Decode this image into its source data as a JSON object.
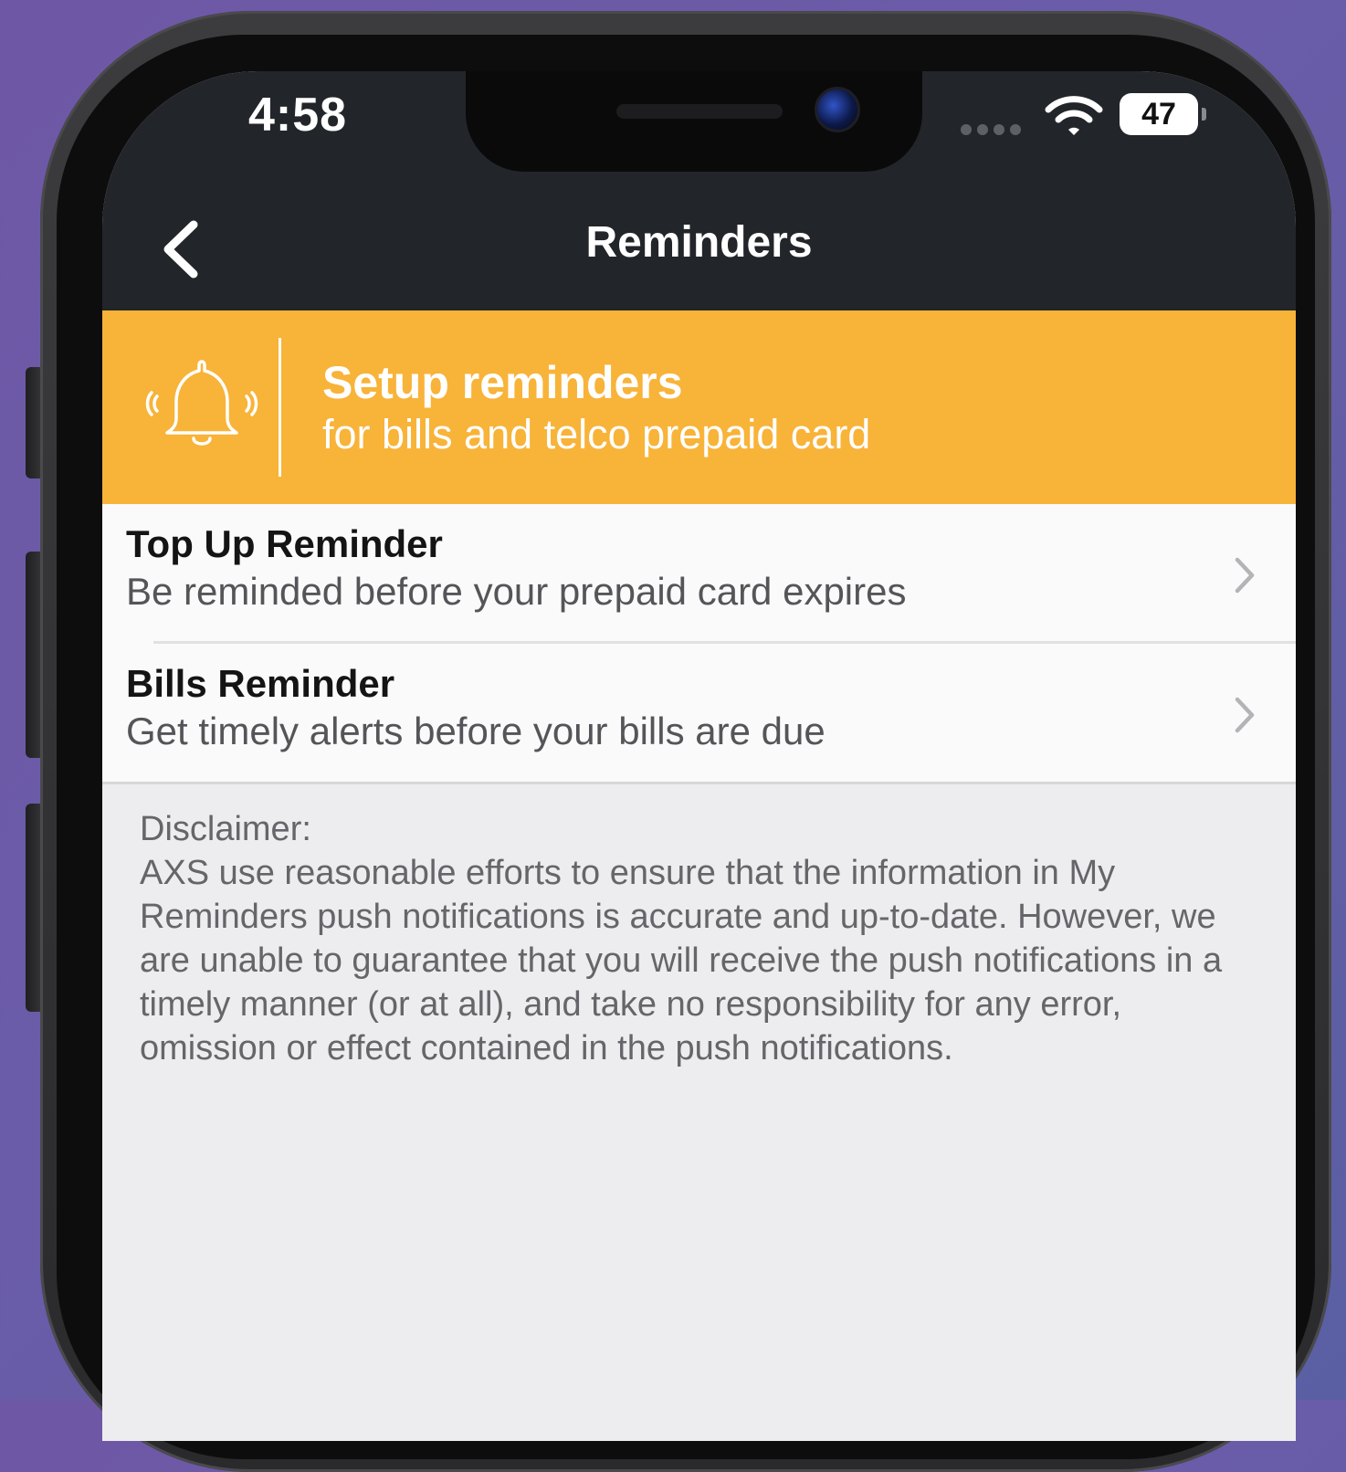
{
  "status_bar": {
    "time": "4:58",
    "battery_level": "47"
  },
  "nav": {
    "title": "Reminders",
    "back_icon": "chevron-left-icon"
  },
  "banner": {
    "icon": "bell-icon",
    "title": "Setup reminders",
    "subtitle": "for bills and telco prepaid card",
    "background_color": "#f8b339"
  },
  "reminders": [
    {
      "title": "Top Up Reminder",
      "subtitle": "Be reminded before your prepaid card expires"
    },
    {
      "title": "Bills Reminder",
      "subtitle": "Get timely alerts before your bills are due"
    }
  ],
  "disclaimer": {
    "heading": "Disclaimer:",
    "body": "AXS use reasonable efforts to ensure that the information in My Reminders push notifications is accurate and up-to-date. However, we are unable to guarantee that you will receive the push notifications in a timely manner (or at all), and take no responsibility for any error, omission or effect contained in the push notifications."
  },
  "colors": {
    "header": "#222529",
    "accent": "#f8b339",
    "page_background": "#ededf0"
  }
}
